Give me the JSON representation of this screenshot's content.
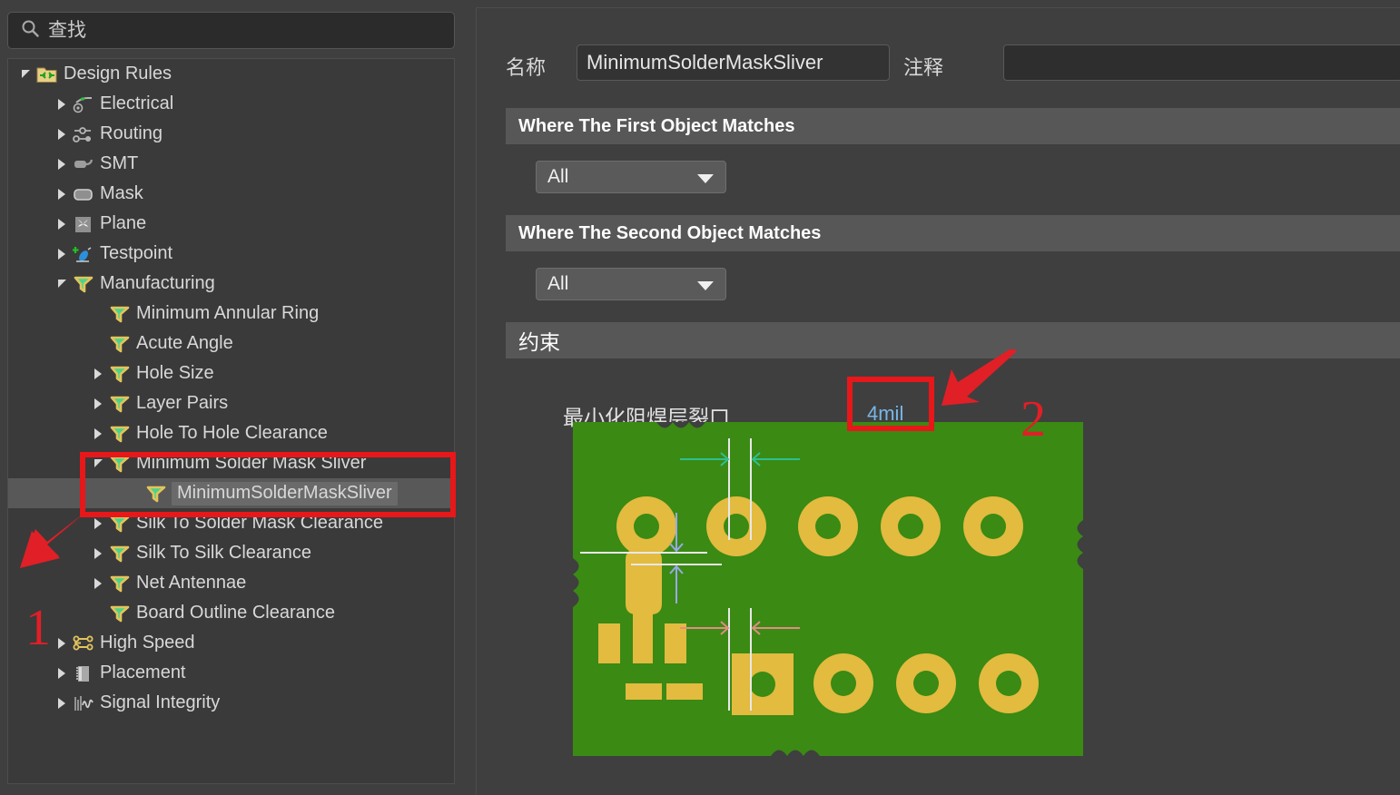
{
  "search": {
    "placeholder": "查找",
    "value": "查找",
    "icon": "search-icon"
  },
  "tree": {
    "root": {
      "label": "Design Rules",
      "icon": "design-rules-folder-icon",
      "expanded": true,
      "depth": 0
    },
    "items": [
      {
        "label": "Electrical",
        "icon": "electrical-icon",
        "depth": 1,
        "twisty": "collapsed",
        "selected": false
      },
      {
        "label": "Routing",
        "icon": "routing-icon",
        "depth": 1,
        "twisty": "collapsed",
        "selected": false
      },
      {
        "label": "SMT",
        "icon": "smt-icon",
        "depth": 1,
        "twisty": "collapsed",
        "selected": false
      },
      {
        "label": "Mask",
        "icon": "mask-icon",
        "depth": 1,
        "twisty": "collapsed",
        "selected": false
      },
      {
        "label": "Plane",
        "icon": "plane-icon",
        "depth": 1,
        "twisty": "collapsed",
        "selected": false
      },
      {
        "label": "Testpoint",
        "icon": "testpoint-icon",
        "depth": 1,
        "twisty": "collapsed",
        "selected": false
      },
      {
        "label": "Manufacturing",
        "icon": "manufacturing-icon",
        "depth": 1,
        "twisty": "expanded",
        "selected": false
      },
      {
        "label": "Minimum Annular Ring",
        "icon": "manufacturing-icon",
        "depth": 2,
        "twisty": "none",
        "selected": false
      },
      {
        "label": "Acute Angle",
        "icon": "manufacturing-icon",
        "depth": 2,
        "twisty": "none",
        "selected": false
      },
      {
        "label": "Hole Size",
        "icon": "manufacturing-icon",
        "depth": 2,
        "twisty": "collapsed",
        "selected": false
      },
      {
        "label": "Layer Pairs",
        "icon": "manufacturing-icon",
        "depth": 2,
        "twisty": "collapsed",
        "selected": false
      },
      {
        "label": "Hole To Hole Clearance",
        "icon": "manufacturing-icon",
        "depth": 2,
        "twisty": "collapsed",
        "selected": false
      },
      {
        "label": "Minimum Solder Mask Sliver",
        "icon": "manufacturing-icon",
        "depth": 2,
        "twisty": "expanded",
        "selected": false
      },
      {
        "label": "MinimumSolderMaskSliver",
        "icon": "manufacturing-icon",
        "depth": 3,
        "twisty": "none",
        "selected": true
      },
      {
        "label": "Silk To Solder Mask Clearance",
        "icon": "manufacturing-icon",
        "depth": 2,
        "twisty": "collapsed",
        "selected": false
      },
      {
        "label": "Silk To Silk Clearance",
        "icon": "manufacturing-icon",
        "depth": 2,
        "twisty": "collapsed",
        "selected": false
      },
      {
        "label": "Net Antennae",
        "icon": "manufacturing-icon",
        "depth": 2,
        "twisty": "collapsed",
        "selected": false
      },
      {
        "label": "Board Outline Clearance",
        "icon": "manufacturing-icon",
        "depth": 2,
        "twisty": "none",
        "selected": false
      },
      {
        "label": "High Speed",
        "icon": "high-speed-icon",
        "depth": 1,
        "twisty": "collapsed",
        "selected": false
      },
      {
        "label": "Placement",
        "icon": "placement-icon",
        "depth": 1,
        "twisty": "collapsed",
        "selected": false
      },
      {
        "label": "Signal Integrity",
        "icon": "signal-integrity-icon",
        "depth": 1,
        "twisty": "collapsed",
        "selected": false
      }
    ]
  },
  "details": {
    "name_label": "名称",
    "name_value": "MinimumSolderMaskSliver",
    "comment_label": "注释",
    "comment_value": "",
    "first_object_section": "Where The First Object Matches",
    "first_object_scope": "All",
    "second_object_section": "Where The Second Object Matches",
    "second_object_scope": "All",
    "constraints_section": "约束",
    "constraint_label": "最小化阻焊层裂口",
    "constraint_value": "4mil"
  },
  "annotations": {
    "marker_one": "1",
    "marker_two": "2",
    "highlight_color": "#e8171a",
    "value_color": "#78b6e8"
  },
  "pcb_preview": {
    "board_color": "#3a8a14",
    "pad_color": "#e2bb3f",
    "green_dimension_color": "#2fbf8f",
    "pink_dimension_color": "#e08d82",
    "white_dimension_color": "#e8e8e8",
    "blue_dimension_color": "#9aa8e8"
  }
}
